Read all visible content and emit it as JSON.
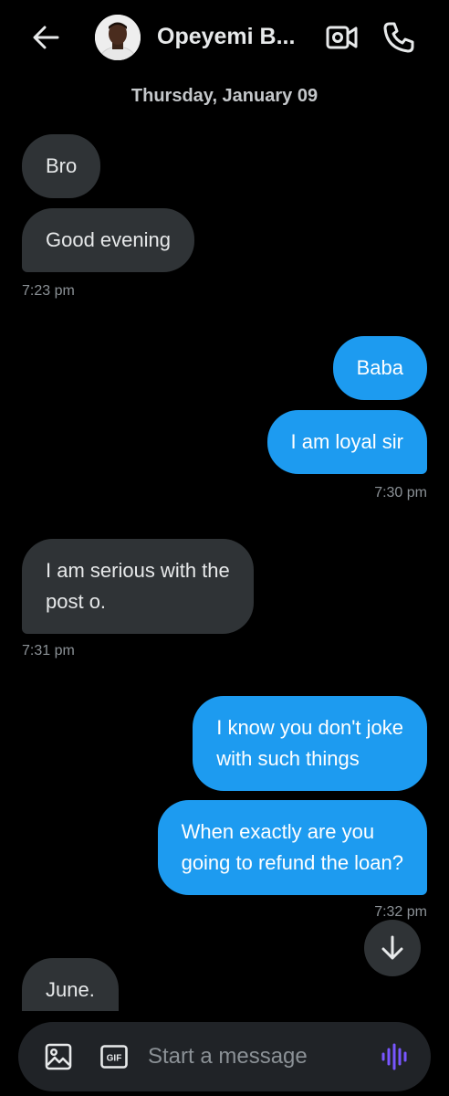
{
  "header": {
    "contact_name": "Opeyemi B...",
    "back_icon": "arrow-left-icon",
    "video_icon": "video-call-icon",
    "call_icon": "phone-icon"
  },
  "date_separator": "Thursday, January 09",
  "messages": [
    {
      "from": "them",
      "text": "Bro"
    },
    {
      "from": "them",
      "text": "Good evening"
    },
    {
      "timestamp": "7:23 pm"
    },
    {
      "from": "me",
      "text": "Baba"
    },
    {
      "from": "me",
      "text": "I am loyal sir"
    },
    {
      "timestamp": "7:30 pm"
    },
    {
      "from": "them",
      "text_lines": [
        "I am serious with the",
        "post o."
      ]
    },
    {
      "timestamp": "7:31 pm"
    },
    {
      "from": "me",
      "text_lines": [
        "I know you don't joke",
        "with such things"
      ]
    },
    {
      "from": "me",
      "text_lines": [
        "When exactly are you",
        "going to refund the loan?"
      ]
    },
    {
      "timestamp": "7:32 pm"
    },
    {
      "from": "them",
      "text": "June."
    }
  ],
  "composer": {
    "placeholder": "Start a message",
    "gif_label": "GIF"
  },
  "colors": {
    "background": "#000000",
    "incoming_bubble": "#2f3336",
    "outgoing_bubble": "#1d9bf0",
    "accent_voice": "#7856ff"
  }
}
